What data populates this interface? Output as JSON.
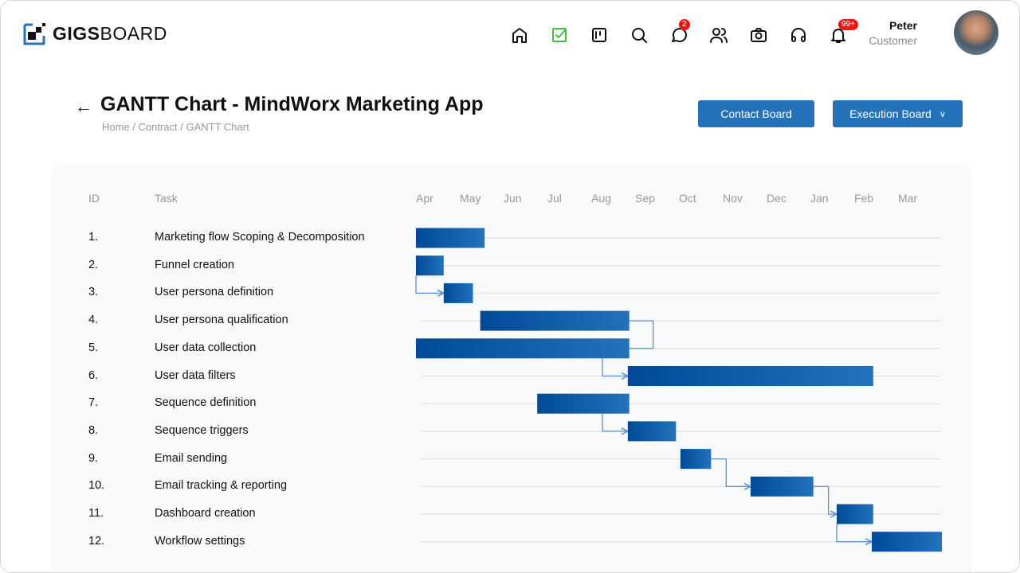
{
  "app": {
    "logo_bold": "GIGS",
    "logo_light": "BOARD"
  },
  "nav": [
    {
      "icon": "home-icon"
    },
    {
      "icon": "tasks-check-icon",
      "color": "#3cc23c"
    },
    {
      "icon": "board-icon"
    },
    {
      "icon": "search-icon"
    },
    {
      "icon": "chat-icon",
      "badge": "2"
    },
    {
      "icon": "users-icon"
    },
    {
      "icon": "camera-icon"
    },
    {
      "icon": "headphones-icon"
    },
    {
      "icon": "bell-icon",
      "badge": "99+"
    }
  ],
  "user": {
    "name": "Peter",
    "role": "Customer"
  },
  "page": {
    "title": "GANTT Chart - MindWorx Marketing App",
    "breadcrumb": "Home / Contract / GANTT Chart"
  },
  "buttons": {
    "contact": "Contact Board",
    "execution": "Execution Board"
  },
  "table": {
    "id_header": "ID",
    "task_header": "Task"
  },
  "colors": {
    "accent": "#2372ba",
    "bar_start": "#004a97",
    "bar_end": "#2372ba",
    "connector": "#5b8fd6"
  },
  "chart_data": {
    "type": "gantt",
    "months": [
      "Apr",
      "May",
      "Jun",
      "Jul",
      "Aug",
      "Sep",
      "Oct",
      "Nov",
      "Dec",
      "Jan",
      "Feb",
      "Mar"
    ],
    "tasks": [
      {
        "id": "1.",
        "name": "Marketing flow Scoping & Decomposition",
        "start": "Apr 1",
        "end": "May 18"
      },
      {
        "id": "2.",
        "name": "Funnel creation",
        "start": "Apr 1",
        "end": "Apr 20"
      },
      {
        "id": "3.",
        "name": "User persona definition",
        "start": "Apr 20",
        "end": "May 10"
      },
      {
        "id": "4.",
        "name": "User persona qualification",
        "start": "May 15",
        "end": "Aug 27"
      },
      {
        "id": "5.",
        "name": "User data collection",
        "start": "Apr 1",
        "end": "Aug 27"
      },
      {
        "id": "6.",
        "name": "User data filters",
        "start": "Aug 26",
        "end": "Feb 14"
      },
      {
        "id": "7.",
        "name": "Sequence definition",
        "start": "Jun 24",
        "end": "Aug 27"
      },
      {
        "id": "8.",
        "name": "Sequence triggers",
        "start": "Aug 26",
        "end": "Sep 29"
      },
      {
        "id": "9.",
        "name": "Email sending",
        "start": "Oct 2",
        "end": "Oct 23"
      },
      {
        "id": "10.",
        "name": "Email tracking & reporting",
        "start": "Nov 20",
        "end": "Jan 3"
      },
      {
        "id": "11.",
        "name": "Dashboard creation",
        "start": "Jan 19",
        "end": "Feb 14"
      },
      {
        "id": "12.",
        "name": "Workflow settings",
        "start": "Feb 13",
        "end": "Mar 31"
      }
    ],
    "dependencies": [
      [
        2,
        3
      ],
      [
        4,
        5
      ],
      [
        5,
        6
      ],
      [
        7,
        8
      ],
      [
        9,
        10
      ],
      [
        10,
        11
      ],
      [
        11,
        12
      ]
    ]
  }
}
